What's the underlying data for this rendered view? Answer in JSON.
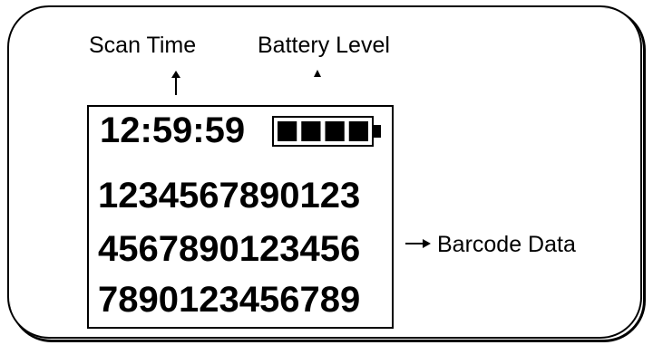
{
  "labels": {
    "scan_time": "Scan Time",
    "battery_level": "Battery Level",
    "barcode_data": "Barcode Data"
  },
  "screen": {
    "time": "12:59:59",
    "battery_level": 1.0,
    "battery_bars": 4,
    "barcode_lines": [
      "1234567890123",
      "4567890123456",
      "7890123456789"
    ]
  },
  "colors": {
    "ink": "#000000",
    "background": "#ffffff"
  }
}
